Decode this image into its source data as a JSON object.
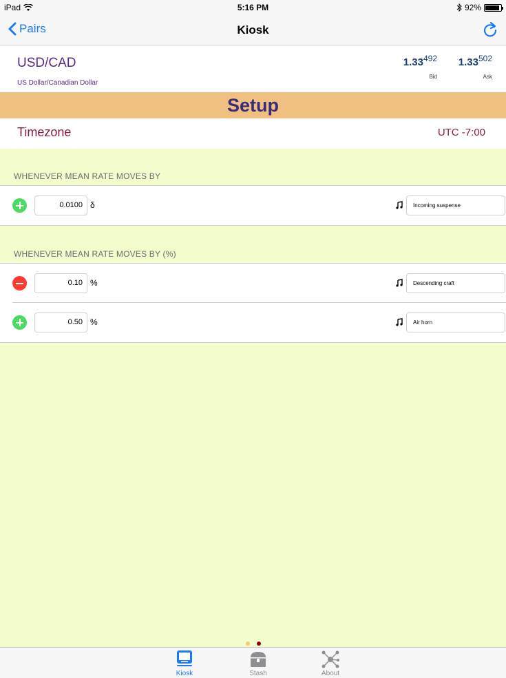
{
  "status_bar": {
    "device": "iPad",
    "time": "5:16 PM",
    "battery": "92%",
    "battery_level": 0.92
  },
  "nav": {
    "back_label": "Pairs",
    "title": "Kiosk"
  },
  "pair": {
    "code": "USD/CAD",
    "name": "US Dollar/Canadian Dollar",
    "bid": {
      "big": "1.33",
      "small": "492",
      "label": "Bid"
    },
    "ask": {
      "big": "1.33",
      "small": "502",
      "label": "Ask"
    }
  },
  "setup_title": "Setup",
  "timezone": {
    "label": "Timezone",
    "value": "UTC -7:00"
  },
  "sections": [
    {
      "header": "WHENEVER MEAN RATE MOVES BY",
      "rows": [
        {
          "action": "add",
          "value": "0.0100",
          "unit": "δ",
          "sound": "Incoming suspense"
        }
      ]
    },
    {
      "header": "WHENEVER MEAN RATE MOVES BY (%)",
      "rows": [
        {
          "action": "remove",
          "value": "0.10",
          "unit": "%",
          "sound": "Descending craft"
        },
        {
          "action": "add",
          "value": "0.50",
          "unit": "%",
          "sound": "Air horn"
        }
      ]
    }
  ],
  "page_dots": {
    "count": 2,
    "active_index": 1,
    "colors": [
      "#f5c878",
      "#8b0000"
    ]
  },
  "tabs": [
    {
      "label": "Kiosk",
      "icon": "kiosk-icon",
      "active": true
    },
    {
      "label": "Stash",
      "icon": "chest-icon",
      "active": false
    },
    {
      "label": "About",
      "icon": "network-icon",
      "active": false
    }
  ],
  "colors": {
    "accent": "#1a7cf5",
    "banner": "#f0c080",
    "page_background": "#f3fccc",
    "pair_text": "#5a2a8a",
    "timezone_text": "#8a1a4a"
  }
}
